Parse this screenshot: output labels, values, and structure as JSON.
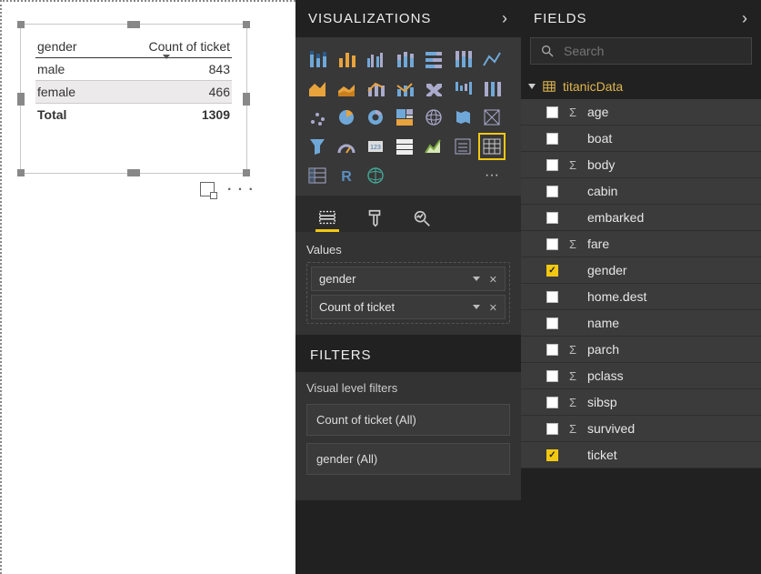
{
  "canvas": {
    "table": {
      "headers": [
        "gender",
        "Count of ticket"
      ],
      "rows": [
        {
          "gender": "male",
          "count": "843",
          "alt": false
        },
        {
          "gender": "female",
          "count": "466",
          "alt": true
        }
      ],
      "total_label": "Total",
      "total_value": "1309"
    }
  },
  "viz": {
    "title": "VISUALIZATIONS",
    "values_label": "Values",
    "wells": [
      {
        "label": "gender"
      },
      {
        "label": "Count of ticket"
      }
    ],
    "filters_title": "FILTERS",
    "filters_sub": "Visual level filters",
    "filters": [
      {
        "label": "Count of ticket (All)"
      },
      {
        "label": "gender (All)"
      }
    ]
  },
  "fields": {
    "title": "FIELDS",
    "search_placeholder": "Search",
    "table_name": "titanicData",
    "items": [
      {
        "name": "age",
        "sigma": true,
        "checked": false
      },
      {
        "name": "boat",
        "sigma": false,
        "checked": false
      },
      {
        "name": "body",
        "sigma": true,
        "checked": false
      },
      {
        "name": "cabin",
        "sigma": false,
        "checked": false
      },
      {
        "name": "embarked",
        "sigma": false,
        "checked": false
      },
      {
        "name": "fare",
        "sigma": true,
        "checked": false
      },
      {
        "name": "gender",
        "sigma": false,
        "checked": true
      },
      {
        "name": "home.dest",
        "sigma": false,
        "checked": false
      },
      {
        "name": "name",
        "sigma": false,
        "checked": false
      },
      {
        "name": "parch",
        "sigma": true,
        "checked": false
      },
      {
        "name": "pclass",
        "sigma": true,
        "checked": false
      },
      {
        "name": "sibsp",
        "sigma": true,
        "checked": false
      },
      {
        "name": "survived",
        "sigma": true,
        "checked": false
      },
      {
        "name": "ticket",
        "sigma": false,
        "checked": true
      }
    ]
  },
  "chart_data": {
    "type": "table",
    "columns": [
      "gender",
      "Count of ticket"
    ],
    "rows": [
      [
        "male",
        843
      ],
      [
        "female",
        466
      ]
    ],
    "total": 1309
  }
}
